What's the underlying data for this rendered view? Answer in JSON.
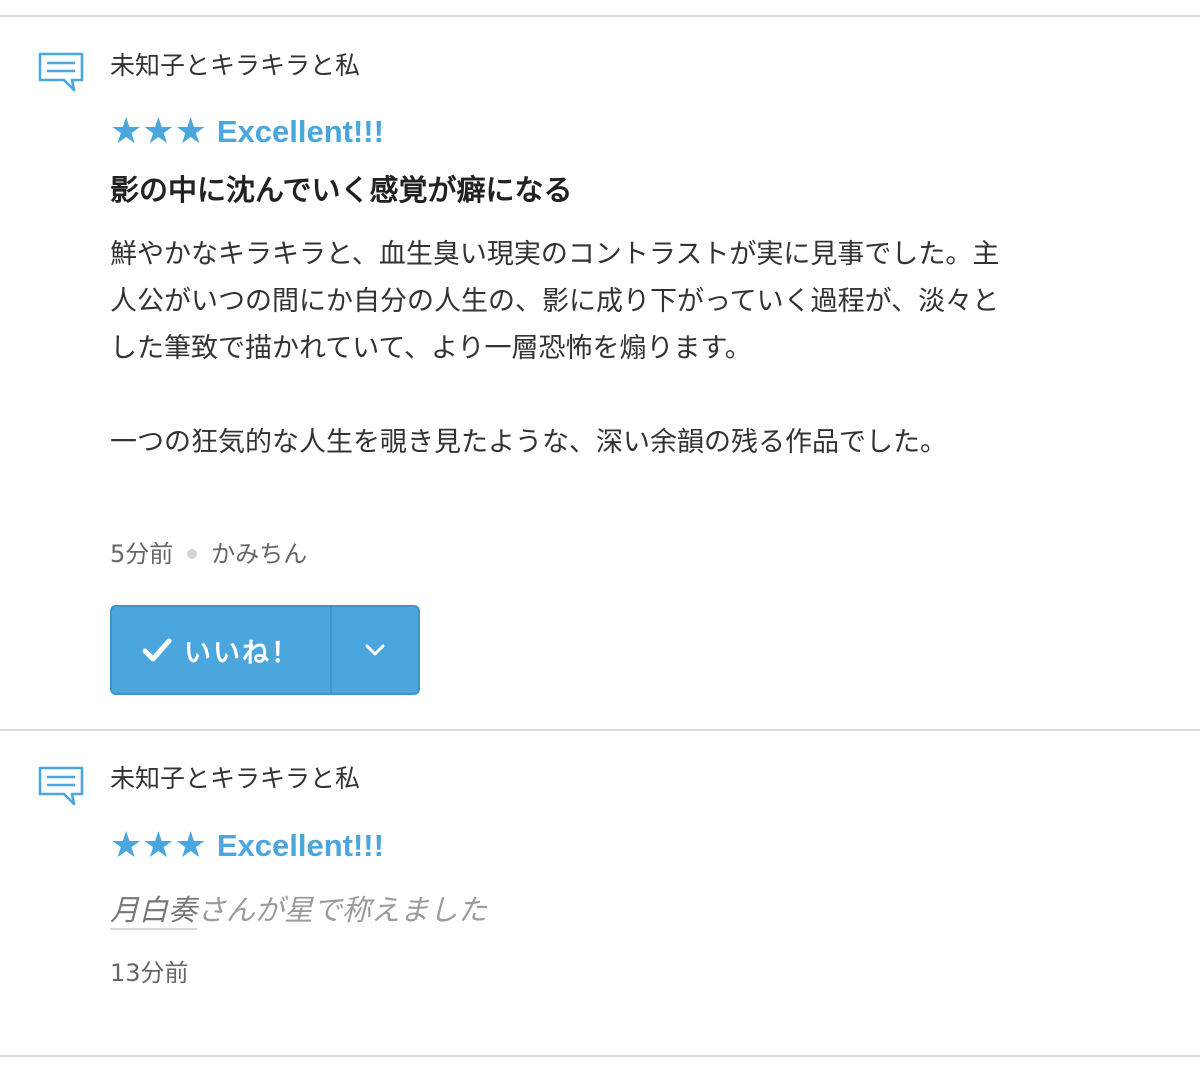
{
  "colors": {
    "accent": "#4aa6dc",
    "divider": "#dcdcdc",
    "text": "#333333",
    "muted": "#666666"
  },
  "entries": [
    {
      "type": "review",
      "icon": "comment-icon",
      "work_title": "未知子とキラキラと私",
      "stars": "★★★",
      "rating_label": "Excellent!!!",
      "review_title": "影の中に沈んでいく感覚が癖になる",
      "body_lines": [
        "鮮やかなキラキラと、血生臭い現実のコントラストが実に見事でした。主",
        "人公がいつの間にか自分の人生の、影に成り下がっていく過程が、淡々と",
        "した筆致で描かれていて、より一層恐怖を煽ります。",
        "",
        "一つの狂気的な人生を覗き見たような、深い余韻の残る作品でした。"
      ],
      "time": "5分前",
      "author": "かみちん",
      "like_label": "いいね！"
    },
    {
      "type": "rating",
      "icon": "comment-icon",
      "work_title": "未知子とキラキラと私",
      "stars": "★★★",
      "rating_label": "Excellent!!!",
      "user": "月白奏",
      "activity_text": "さんが星で称えました",
      "time": "13分前"
    }
  ]
}
